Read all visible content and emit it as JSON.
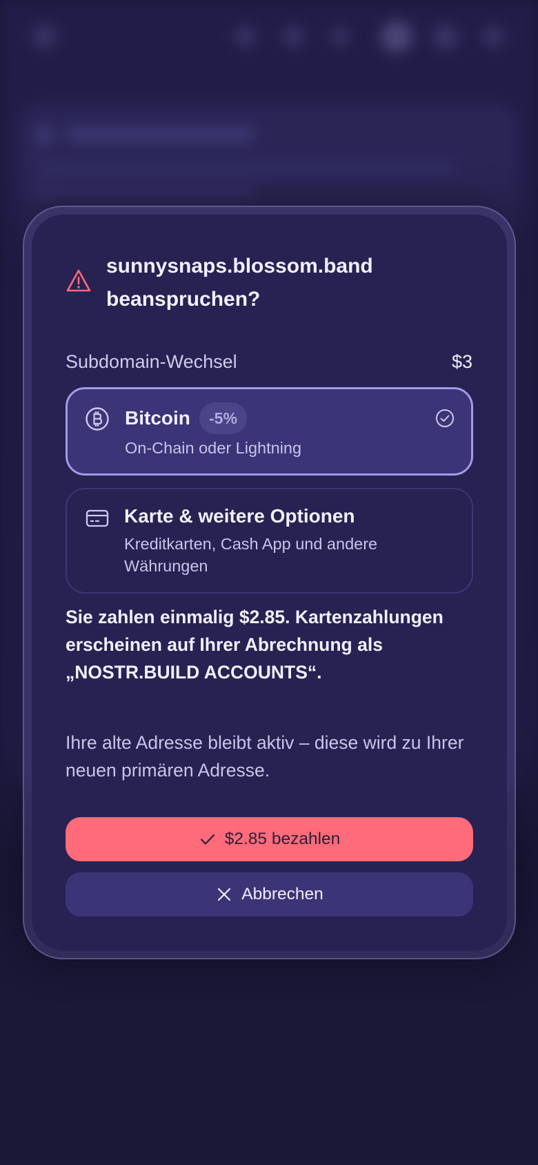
{
  "dialog": {
    "title": "sunnysnaps.blossom.band beanspruchen?",
    "fee_label": "Subdomain-Wechsel",
    "fee_price": "$3"
  },
  "options": [
    {
      "title": "Bitcoin",
      "badge": "-5%",
      "description": "On-Chain oder Lightning",
      "icon": "bitcoin-icon",
      "selected": true
    },
    {
      "title": "Karte & weitere Optionen",
      "description": "Kreditkarten, Cash App und andere Währungen",
      "icon": "credit-card-icon",
      "selected": false
    }
  ],
  "info": {
    "billing_note": "Sie zahlen einmalig $2.85. Kartenzahlungen erscheinen auf Ihrer Abrechnung als „NOSTR.BUILD ACCOUNTS“.",
    "address_note": "Ihre alte Adresse bleibt aktiv – diese wird zu Ihrer neuen primären Adresse."
  },
  "actions": {
    "pay_label": "$2.85 bezahlen",
    "cancel_label": "Abbrechen"
  },
  "colors": {
    "background": "#1a1737",
    "dialog": "#272252",
    "accent": "#ff6b78",
    "selected_option": "#3b3477",
    "selected_border": "#a49be6",
    "warning": "#ff6b78"
  }
}
